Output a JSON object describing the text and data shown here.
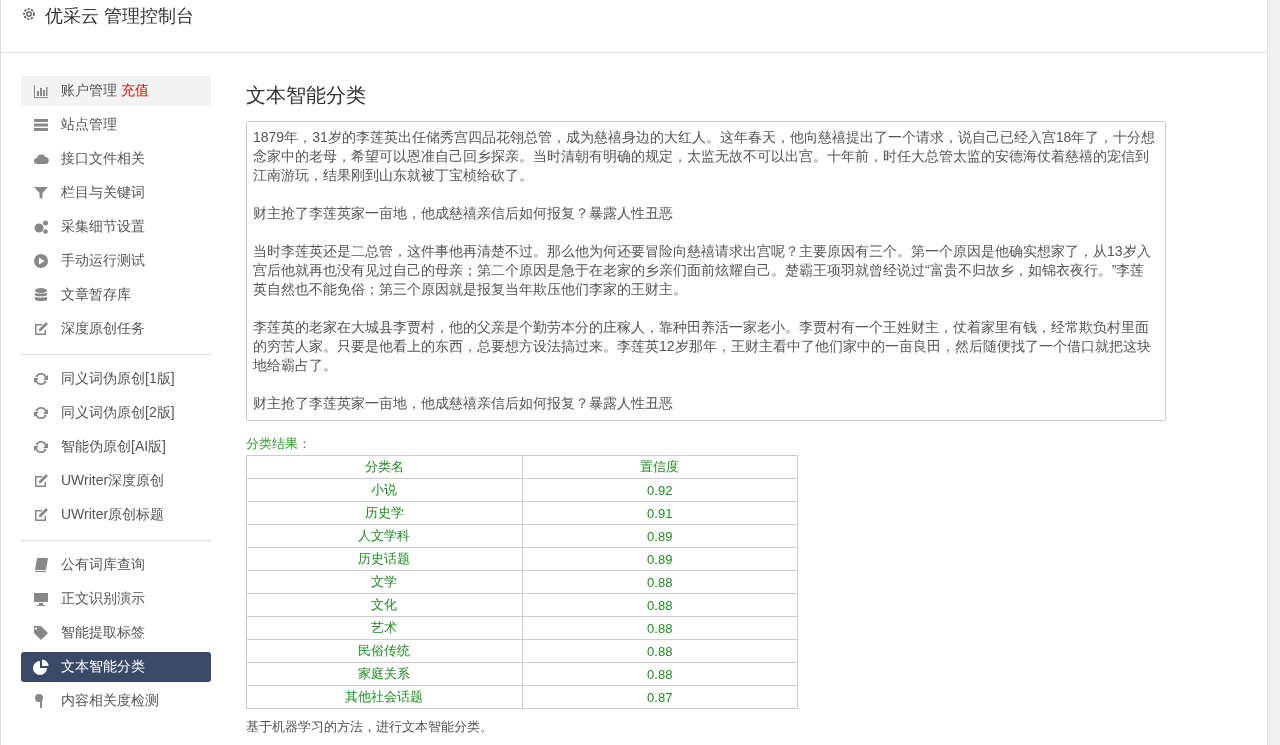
{
  "header": {
    "title": "优采云 管理控制台"
  },
  "sidebar": {
    "groups": [
      {
        "items": [
          {
            "label": "账户管理",
            "badge": "充值",
            "selected": false,
            "highlighted": true
          },
          {
            "label": "站点管理",
            "selected": false,
            "highlighted": false
          },
          {
            "label": "接口文件相关",
            "selected": false,
            "highlighted": false
          },
          {
            "label": "栏目与关键词",
            "selected": false,
            "highlighted": false
          },
          {
            "label": "采集细节设置",
            "selected": false,
            "highlighted": false
          },
          {
            "label": "手动运行测试",
            "selected": false,
            "highlighted": false
          },
          {
            "label": "文章暂存库",
            "selected": false,
            "highlighted": false
          },
          {
            "label": "深度原创任务",
            "selected": false,
            "highlighted": false
          }
        ]
      },
      {
        "items": [
          {
            "label": "同义词伪原创[1版]",
            "selected": false,
            "highlighted": false
          },
          {
            "label": "同义词伪原创[2版]",
            "selected": false,
            "highlighted": false
          },
          {
            "label": "智能伪原创[AI版]",
            "selected": false,
            "highlighted": false
          },
          {
            "label": "UWriter深度原创",
            "selected": false,
            "highlighted": false
          },
          {
            "label": "UWriter原创标题",
            "selected": false,
            "highlighted": false
          }
        ]
      },
      {
        "items": [
          {
            "label": "公有词库查询",
            "selected": false,
            "highlighted": false
          },
          {
            "label": "正文识别演示",
            "selected": false,
            "highlighted": false
          },
          {
            "label": "智能提取标签",
            "selected": false,
            "highlighted": false
          },
          {
            "label": "文本智能分类",
            "selected": true,
            "highlighted": false
          },
          {
            "label": "内容相关度检测",
            "selected": false,
            "highlighted": false
          }
        ]
      }
    ]
  },
  "main": {
    "title": "文本智能分类",
    "text_field": {
      "paragraphs": [
        "1879年，31岁的李莲英出任储秀宫四品花翎总管，成为慈禧身边的大红人。这年春天，他向慈禧提出了一个请求，说自己已经入宫18年了，十分想念家中的老母，希望可以恩准自己回乡探亲。当时清朝有明确的规定，太监无故不可以出宫。十年前，时任大总管太监的安德海仗着慈禧的宠信到江南游玩，结果刚到山东就被丁宝桢给砍了。",
        "财主抢了李莲英家一亩地，他成慈禧亲信后如何报复？暴露人性丑恶",
        "当时李莲英还是二总管，这件事他再清楚不过。那么他为何还要冒险向慈禧请求出宫呢？主要原因有三个。第一个原因是他确实想家了，从13岁入宫后他就再也没有见过自己的母亲；第二个原因是急于在老家的乡亲们面前炫耀自己。楚霸王项羽就曾经说过“富贵不归故乡，如锦衣夜行。”李莲英自然也不能免俗；第三个原因就是报复当年欺压他们李家的王财主。",
        "李莲英的老家在大城县李贾村，他的父亲是个勤劳本分的庄稼人，靠种田养活一家老小。李贾村有一个王姓财主，仗着家里有钱，经常欺负村里面的穷苦人家。只要是他看上的东西，总要想方设法搞过来。李莲英12岁那年，王财主看中了他们家中的一亩良田，然后随便找了一个借口就把这块地给霸占了。",
        "财主抢了李莲英家一亩地，他成慈禧亲信后如何报复？暴露人性丑恶"
      ]
    },
    "result_label": "分类结果：",
    "table": {
      "columns": [
        "分类名",
        "置信度"
      ],
      "rows": [
        [
          "小说",
          "0.92"
        ],
        [
          "历史学",
          "0.91"
        ],
        [
          "人文学科",
          "0.89"
        ],
        [
          "历史话题",
          "0.89"
        ],
        [
          "文学",
          "0.88"
        ],
        [
          "文化",
          "0.88"
        ],
        [
          "艺术",
          "0.88"
        ],
        [
          "民俗传统",
          "0.88"
        ],
        [
          "家庭关系",
          "0.88"
        ],
        [
          "其他社会话题",
          "0.87"
        ]
      ]
    },
    "footer_note": "基于机器学习的方法，进行文本智能分类。"
  }
}
